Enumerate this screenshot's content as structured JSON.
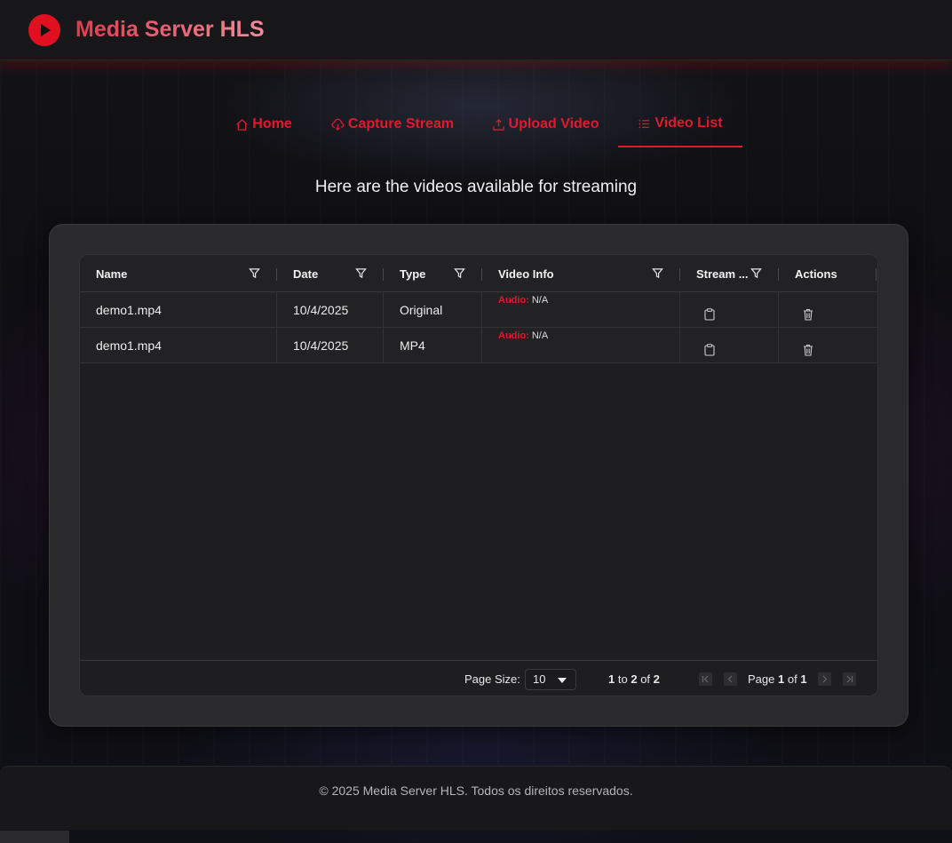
{
  "header": {
    "title": "Media Server HLS"
  },
  "nav": {
    "items": [
      {
        "label": "Home",
        "icon": "home-icon",
        "active": false
      },
      {
        "label": "Capture Stream",
        "icon": "cloud-download-icon",
        "active": false
      },
      {
        "label": "Upload Video",
        "icon": "upload-icon",
        "active": false
      },
      {
        "label": "Video List",
        "icon": "list-icon",
        "active": true
      }
    ]
  },
  "main": {
    "subtitle": "Here are the videos available for streaming"
  },
  "grid": {
    "columns": [
      "Name",
      "Date",
      "Type",
      "Video Info",
      "Stream ...",
      "Actions"
    ],
    "rows": [
      {
        "name": "demo1.mp4",
        "date": "10/4/2025",
        "type": "Original",
        "info_label": "Audio:",
        "info_value": "N/A"
      },
      {
        "name": "demo1.mp4",
        "date": "10/4/2025",
        "type": "MP4",
        "info_label": "Audio:",
        "info_value": "N/A"
      }
    ],
    "pagination": {
      "page_size_label": "Page Size:",
      "page_size": "10",
      "from": "1",
      "to_word": "to",
      "to": "2",
      "of_word": "of",
      "total": "2",
      "page_word": "Page",
      "page": "1",
      "page_of": "of",
      "pages": "1"
    }
  },
  "footer": {
    "text": "© 2025 Media Server HLS. Todos os direitos reservados."
  },
  "colors": {
    "accent": "#e01a2c",
    "panel": "#2a2a2d",
    "grid": "#1e1e20"
  }
}
